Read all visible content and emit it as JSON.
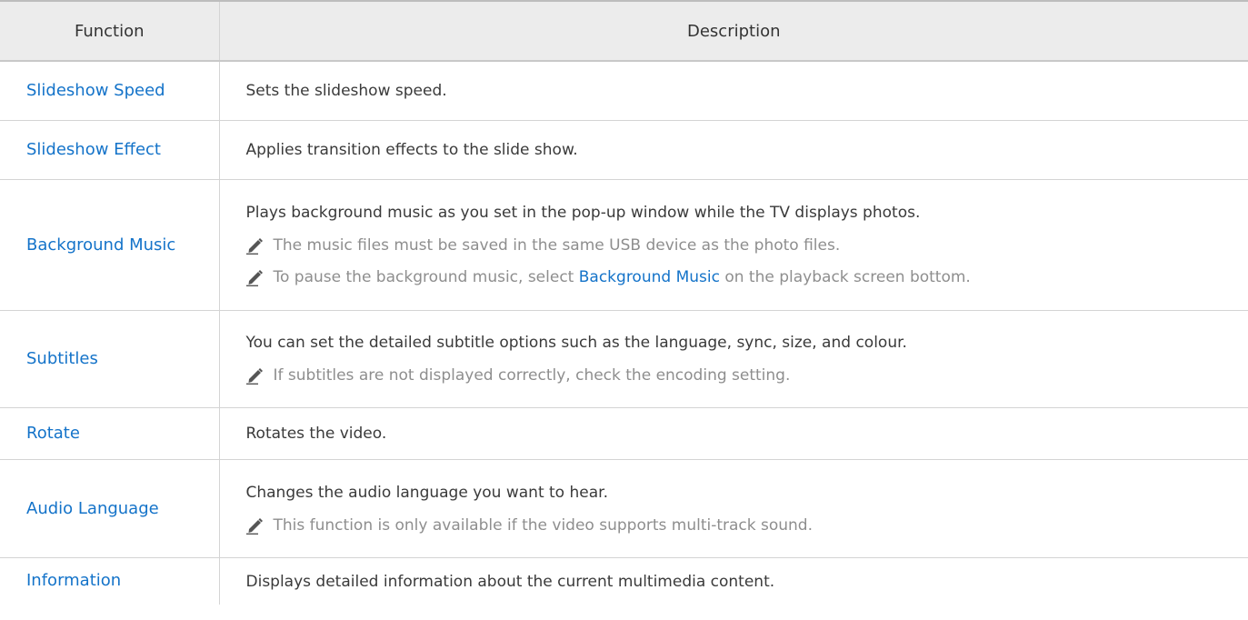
{
  "header": {
    "function": "Function",
    "description": "Description"
  },
  "rows": [
    {
      "function": "Slideshow Speed",
      "description": "Sets the slideshow speed.",
      "notes": []
    },
    {
      "function": "Slideshow Effect",
      "description": "Applies transition effects to the slide show.",
      "notes": []
    },
    {
      "function": "Background Music",
      "description": "Plays background music as you set in the pop-up window while the TV displays photos.",
      "notes": [
        {
          "text": "The music files must be saved in the same USB device as the photo files."
        },
        {
          "before": "To pause the background music, select ",
          "highlight": "Background Music",
          "after": " on the playback screen bottom."
        }
      ]
    },
    {
      "function": "Subtitles",
      "description": "You can set the detailed subtitle options such as the language, sync, size, and colour.",
      "notes": [
        {
          "text": "If subtitles are not displayed correctly, check the encoding setting."
        }
      ]
    },
    {
      "function": "Rotate",
      "description": "Rotates the video.",
      "notes": []
    },
    {
      "function": "Audio Language",
      "description": "Changes the audio language you want to hear.",
      "notes": [
        {
          "text": "This function is only available if the video supports multi-track sound."
        }
      ]
    },
    {
      "function": "Information",
      "description": "Displays detailed information about the current multimedia content.",
      "notes": []
    }
  ],
  "icons": {
    "note": "pencil-note-icon"
  },
  "colors": {
    "function_text": "#1473c9",
    "header_background": "#ececec",
    "note_text": "#8e8e8e"
  }
}
